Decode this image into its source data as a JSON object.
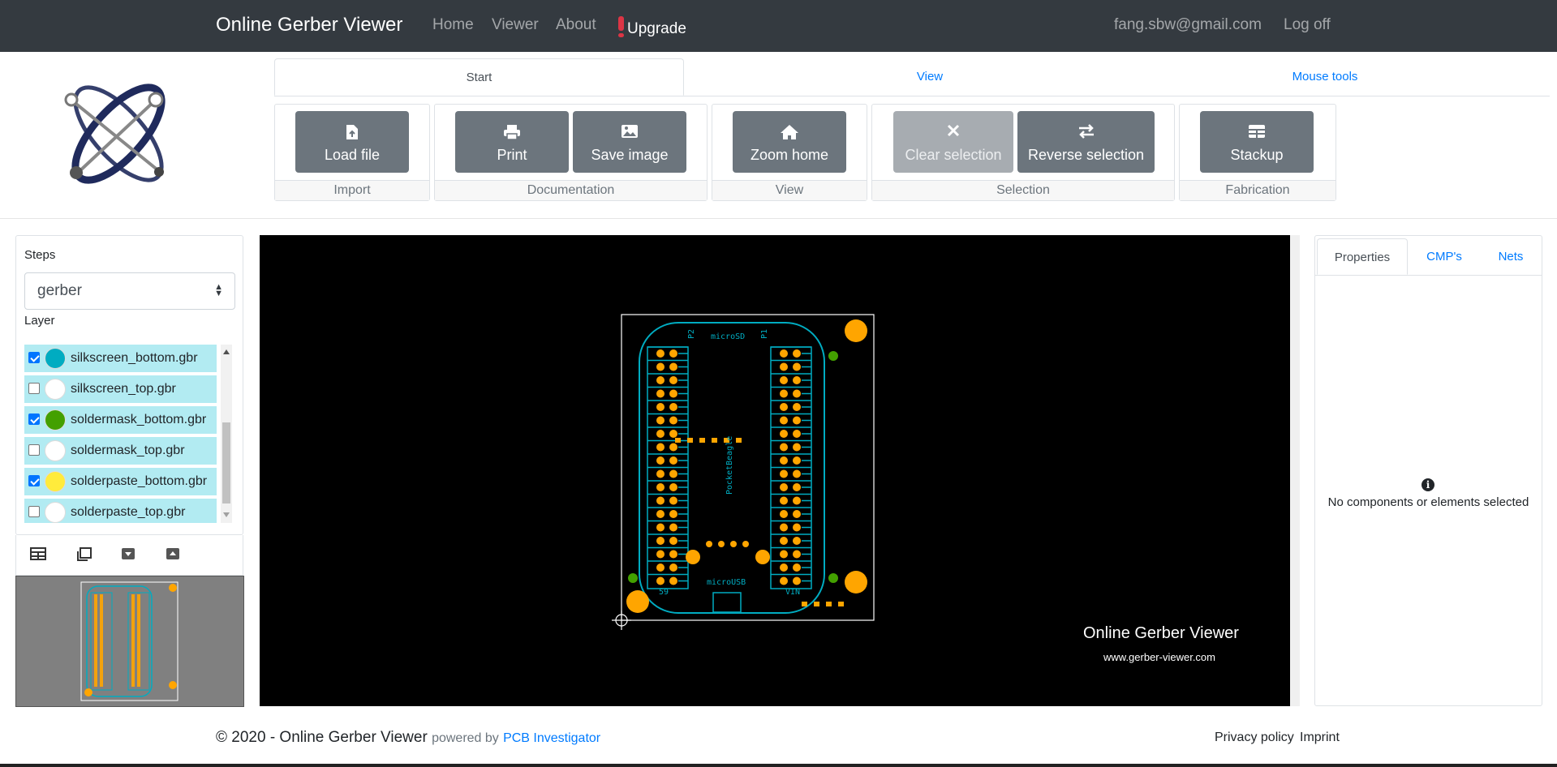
{
  "navbar": {
    "brand": "Online Gerber Viewer",
    "links": [
      "Home",
      "Viewer",
      "About"
    ],
    "upgrade": "Upgrade",
    "email": "fang.sbw@gmail.com",
    "logoff": "Log off"
  },
  "tabs": [
    "Start",
    "View",
    "Mouse tools"
  ],
  "toolbar": {
    "import": {
      "label": "Import",
      "load": "Load file"
    },
    "documentation": {
      "label": "Documentation",
      "print": "Print",
      "save_image": "Save image"
    },
    "view": {
      "label": "View",
      "zoom_home": "Zoom home"
    },
    "selection": {
      "label": "Selection",
      "clear": "Clear selection",
      "reverse": "Reverse selection"
    },
    "fabrication": {
      "label": "Fabrication",
      "stackup": "Stackup"
    }
  },
  "sidebar": {
    "steps_label": "Steps",
    "step_value": "gerber",
    "layer_label": "Layer",
    "layers": [
      {
        "name": "silkscreen_bottom.gbr",
        "checked": true,
        "color": "#00acc1"
      },
      {
        "name": "silkscreen_top.gbr",
        "checked": false,
        "color": "#ffffff"
      },
      {
        "name": "soldermask_bottom.gbr",
        "checked": true,
        "color": "#43a000"
      },
      {
        "name": "soldermask_top.gbr",
        "checked": false,
        "color": "#ffffff"
      },
      {
        "name": "solderpaste_bottom.gbr",
        "checked": true,
        "color": "#ffeb3b"
      },
      {
        "name": "solderpaste_top.gbr",
        "checked": false,
        "color": "#ffffff"
      }
    ]
  },
  "canvas": {
    "watermark_title": "Online Gerber Viewer",
    "watermark_url": "www.gerber-viewer.com",
    "pcb_labels": {
      "microsd": "microSD",
      "microusb": "microUSB",
      "pocket": "PocketBeagle",
      "p2": "P2",
      "p1": "P1",
      "vin": "VIN",
      "p59": "59"
    }
  },
  "right_panel": {
    "tabs": [
      "Properties",
      "CMP's",
      "Nets"
    ],
    "empty_message": "No components or elements selected"
  },
  "footer": {
    "copyright": "© 2020 - Online Gerber Viewer",
    "powered_by": "powered by",
    "powered_link": "PCB Investigator",
    "privacy": "Privacy policy",
    "imprint": "Imprint"
  },
  "colors": {
    "navbar": "#343a40",
    "button": "#6c757d",
    "link": "#007bff",
    "layer_row": "#b2ebf2",
    "trace": "#00acc1",
    "pad": "#ffa500",
    "mask_pad": "#43a000"
  }
}
